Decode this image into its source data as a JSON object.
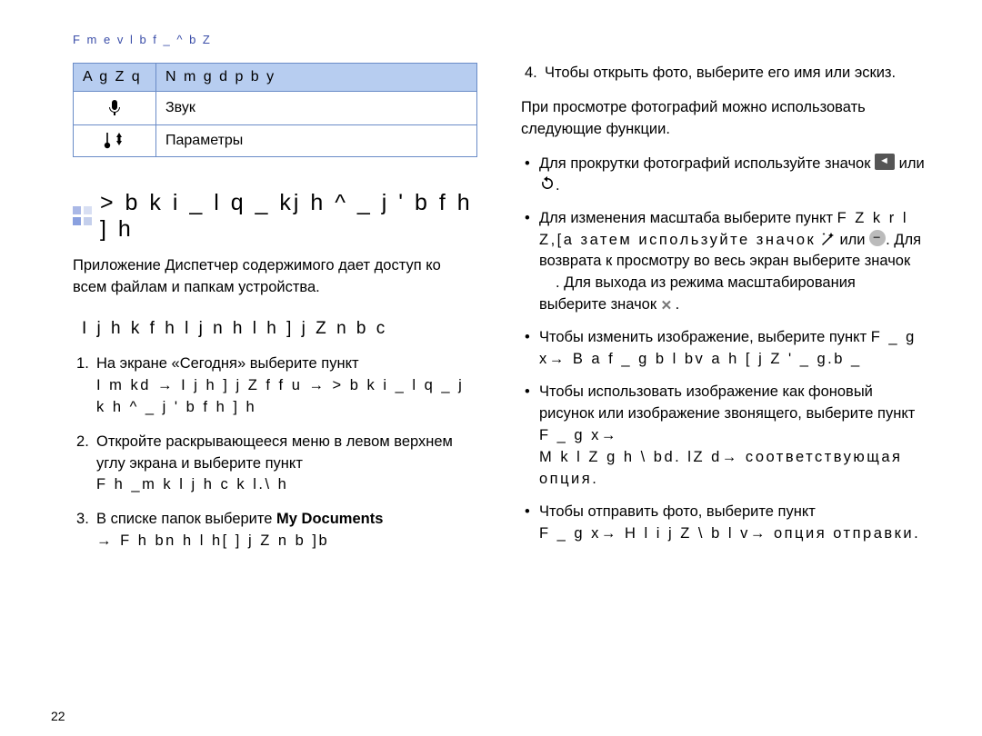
{
  "doc_header": "F m e v l b f _ ^ b Z",
  "table": {
    "headers": [
      "A g Z q",
      "N m g d p b y"
    ],
    "rows": [
      {
        "label": "Звук",
        "icon": "mic-icon"
      },
      {
        "label": "Параметры",
        "icon": "sliders-icon"
      }
    ]
  },
  "section_title": "> b k i _ l q _ kj h ^ _ j ' b f h ] h",
  "intro_text": "Приложение Диспетчер содержимого дает доступ ко всем файлам и папкам устройства.",
  "sub_heading": "I j h k f h l j   n h l h ] j Z n b c",
  "steps": {
    "s1_a": "На экране «Сегодня» выберите пункт",
    "s1_b": "I m kd → I j h ] j Z f f u → > b k i _ l q _ j k h ^ _ j ' b f h ] h",
    "s2_a": "Откройте раскрывающееся меню в левом верхнем углу экрана и выберите пункт",
    "s2_b": "F h _m k l j h c k l.\\ h",
    "s3_a": "В списке папок выберите",
    "s3_b": "My Documents",
    "s3_c": "→  F h bn h l h[ ] j Z n b ]b",
    "s4": "Чтобы открыть фото, выберите его имя или эскиз."
  },
  "right_intro": "При просмотре фотографий можно использовать следующие функции.",
  "bullets": {
    "b1_a": "Для прокрутки фотографий используйте значок",
    "b1_b": "или",
    "b1_c": ".",
    "b2_a": "Для изменения масштаба выберите пункт",
    "b2_b": "F Z k r l Z,[а затем используйте значок",
    "b2_c": "или",
    "b2_d": ". Для возврата к просмотру во весь экран выберите значок",
    "b2_e": ". Для выхода из режима масштабирования выберите значок",
    "b2_f": ".",
    "b3_a": "Чтобы изменить изображение, выберите пункт",
    "b3_b": "F _ g x→  B a f _ g b l bv a h [ j Z ' _ g.b _",
    "b4_a": "Чтобы использовать изображение как фоновый рисунок или изображение звонящего, выберите пункт",
    "b4_b": "F _ g x→",
    "b4_c": "M k l Z g h \\ bd.  lZ d→ соответствующая опция.",
    "b5_a": "Чтобы отправить фото, выберите пункт",
    "b5_b": "F _ g x→  H  l i j Z \\ b l v→ опция отправки."
  },
  "page_num": "22"
}
